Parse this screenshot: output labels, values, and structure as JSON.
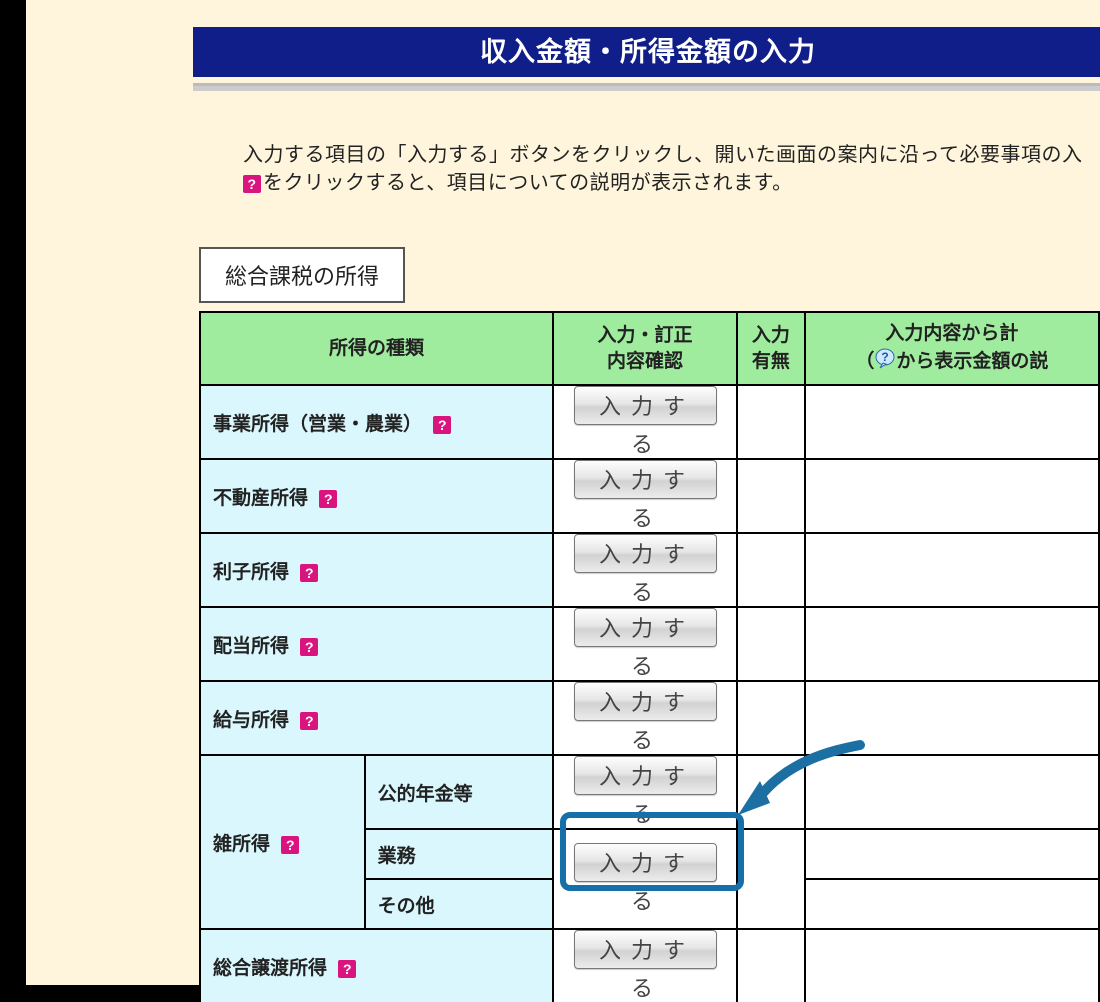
{
  "page_title": "収入金額・所得金額の入力",
  "instructions": {
    "line1": "入力する項目の「入力する」ボタンをクリックし、開いた画面の案内に沿って必要事項の入",
    "line2_prefix": "",
    "line2_after_icon": "をクリックすると、項目についての説明が表示されます。"
  },
  "section_label": "総合課税の所得",
  "table": {
    "headers": {
      "type": "所得の種類",
      "confirm_line1": "入力・訂正",
      "confirm_line2": "内容確認",
      "presence_line1": "入力",
      "presence_line2": "有無",
      "calc_line1": "入力内容から計",
      "calc_prefix": "（",
      "calc_after_icon": "から表示金額の説"
    },
    "button_label": "入力する",
    "rows": [
      {
        "label": "事業所得（営業・農業）",
        "help": true
      },
      {
        "label": "不動産所得",
        "help": true
      },
      {
        "label": "利子所得",
        "help": true
      },
      {
        "label": "配当所得",
        "help": true
      },
      {
        "label": "給与所得",
        "help": true
      }
    ],
    "misc": {
      "group_label": "雑所得",
      "group_help": true,
      "sub": [
        {
          "label": "公的年金等"
        },
        {
          "label": "業務"
        },
        {
          "label": "その他"
        }
      ]
    },
    "last_row": {
      "label": "総合譲渡所得",
      "help": true
    }
  }
}
